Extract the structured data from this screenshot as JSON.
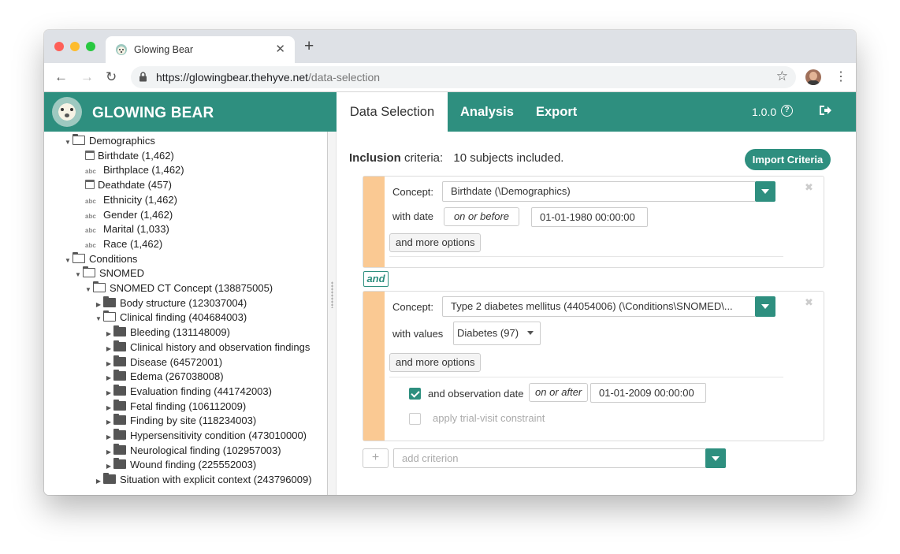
{
  "browser": {
    "tab_title": "Glowing Bear",
    "new_tab_symbol": "+",
    "close_symbol": "✕",
    "url_main": "https://glowingbear.thehyve.net",
    "url_path": "/data-selection"
  },
  "app": {
    "brand": "GLOWING BEAR",
    "nav": [
      "Data Selection",
      "Analysis",
      "Export"
    ],
    "version": "1.0.0",
    "help_symbol": "?",
    "accent_color": "#2e8f7f",
    "criterion_bar_color": "#fac993"
  },
  "tree": [
    {
      "label": "Demographics",
      "icon": "folder-open-icon",
      "toggle": "expanded"
    },
    {
      "label": "Birthdate (1,462)",
      "icon": "calendar-icon"
    },
    {
      "label": "Birthplace (1,462)",
      "icon": "abc-icon"
    },
    {
      "label": "Deathdate (457)",
      "icon": "calendar-icon"
    },
    {
      "label": "Ethnicity (1,462)",
      "icon": "abc-icon"
    },
    {
      "label": "Gender (1,462)",
      "icon": "abc-icon"
    },
    {
      "label": "Marital (1,033)",
      "icon": "abc-icon"
    },
    {
      "label": "Race (1,462)",
      "icon": "abc-icon"
    },
    {
      "label": "Conditions",
      "icon": "folder-open-icon",
      "toggle": "expanded"
    },
    {
      "label": "SNOMED",
      "icon": "folder-open-icon",
      "toggle": "expanded"
    },
    {
      "label": "SNOMED CT Concept (138875005)",
      "icon": "folder-open-icon",
      "toggle": "expanded"
    },
    {
      "label": "Body structure (123037004)",
      "icon": "folder-icon",
      "toggle": "collapsed"
    },
    {
      "label": "Clinical finding (404684003)",
      "icon": "folder-open-icon",
      "toggle": "expanded"
    },
    {
      "label": "Bleeding (131148009)",
      "icon": "folder-icon",
      "toggle": "collapsed"
    },
    {
      "label": "Clinical history and observation findings",
      "icon": "folder-icon",
      "toggle": "collapsed"
    },
    {
      "label": "Disease (64572001)",
      "icon": "folder-icon",
      "toggle": "collapsed"
    },
    {
      "label": "Edema (267038008)",
      "icon": "folder-icon",
      "toggle": "collapsed"
    },
    {
      "label": "Evaluation finding (441742003)",
      "icon": "folder-icon",
      "toggle": "collapsed"
    },
    {
      "label": "Fetal finding (106112009)",
      "icon": "folder-icon",
      "toggle": "collapsed"
    },
    {
      "label": "Finding by site (118234003)",
      "icon": "folder-icon",
      "toggle": "collapsed"
    },
    {
      "label": "Hypersensitivity condition (473010000)",
      "icon": "folder-icon",
      "toggle": "collapsed"
    },
    {
      "label": "Neurological finding (102957003)",
      "icon": "folder-icon",
      "toggle": "collapsed"
    },
    {
      "label": "Wound finding (225552003)",
      "icon": "folder-icon",
      "toggle": "collapsed"
    },
    {
      "label": "Situation with explicit context (243796009)",
      "icon": "folder-icon",
      "toggle": "collapsed"
    }
  ],
  "inclusion": {
    "label_bold": "Inclusion",
    "label_rest": " criteria:",
    "summary": "10 subjects included.",
    "import_button": "Import Criteria"
  },
  "criterion1": {
    "concept_label": "Concept:",
    "concept_value": "Birthdate (\\Demographics)",
    "with_date_label": "with date",
    "date_operator": "on or before",
    "date_value": "01-01-1980 00:00:00",
    "more_options": "and more options"
  },
  "and_label": "and",
  "criterion2": {
    "concept_label": "Concept:",
    "concept_value": "Type 2 diabetes mellitus (44054006) (\\Conditions\\SNOMED\\...",
    "with_values_label": "with values",
    "values_selected": "Diabetes (97)",
    "more_options": "and more options",
    "obs_date_label": "and observation date",
    "obs_date_operator": "on or after",
    "obs_date_value": "01-01-2009 00:00:00",
    "trial_visit_label": "apply trial-visit constraint"
  },
  "add_criterion": {
    "placeholder": "add criterion",
    "plus": "+"
  }
}
